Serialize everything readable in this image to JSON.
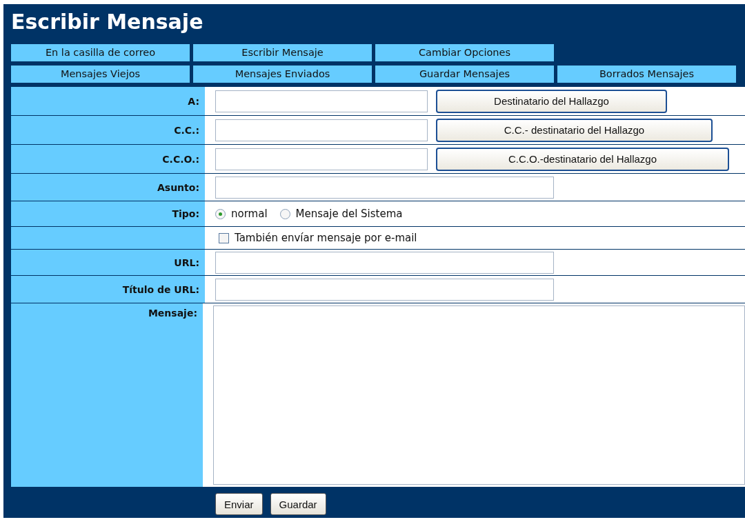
{
  "title": "Escribir Mensaje",
  "tab_rows": [
    [
      {
        "label": "En la casilla de correo"
      },
      {
        "label": "Escribir Mensaje"
      },
      {
        "label": "Cambiar Opciones"
      }
    ],
    [
      {
        "label": "Mensajes Viejos"
      },
      {
        "label": "Mensajes Enviados"
      },
      {
        "label": "Guardar Mensajes"
      },
      {
        "label": "Borrados Mensajes"
      }
    ]
  ],
  "fields": [
    {
      "kind": "recipient",
      "label": "A:",
      "button": "Destinatario del Hallazgo"
    },
    {
      "kind": "recipient",
      "label": "C.C.:",
      "button": "C.C.- destinatario del Hallazgo"
    },
    {
      "kind": "recipient",
      "label": "C.C.O.:",
      "button": "C.C.O.-destinatario del Hallazgo"
    },
    {
      "kind": "text",
      "label": "Asunto:"
    },
    {
      "kind": "radio",
      "label": "Tipo:",
      "options": [
        {
          "label": "normal",
          "selected": true
        },
        {
          "label": "Mensaje del Sistema",
          "selected": false
        }
      ]
    },
    {
      "kind": "checkbox",
      "text": "También envíar mensaje por e-mail",
      "checked": false
    },
    {
      "kind": "text",
      "label": "URL:"
    },
    {
      "kind": "text",
      "label": "Título de URL:"
    },
    {
      "kind": "textarea",
      "label": "Mensaje:"
    }
  ],
  "buttons": [
    "Enviar",
    "Guardar"
  ]
}
